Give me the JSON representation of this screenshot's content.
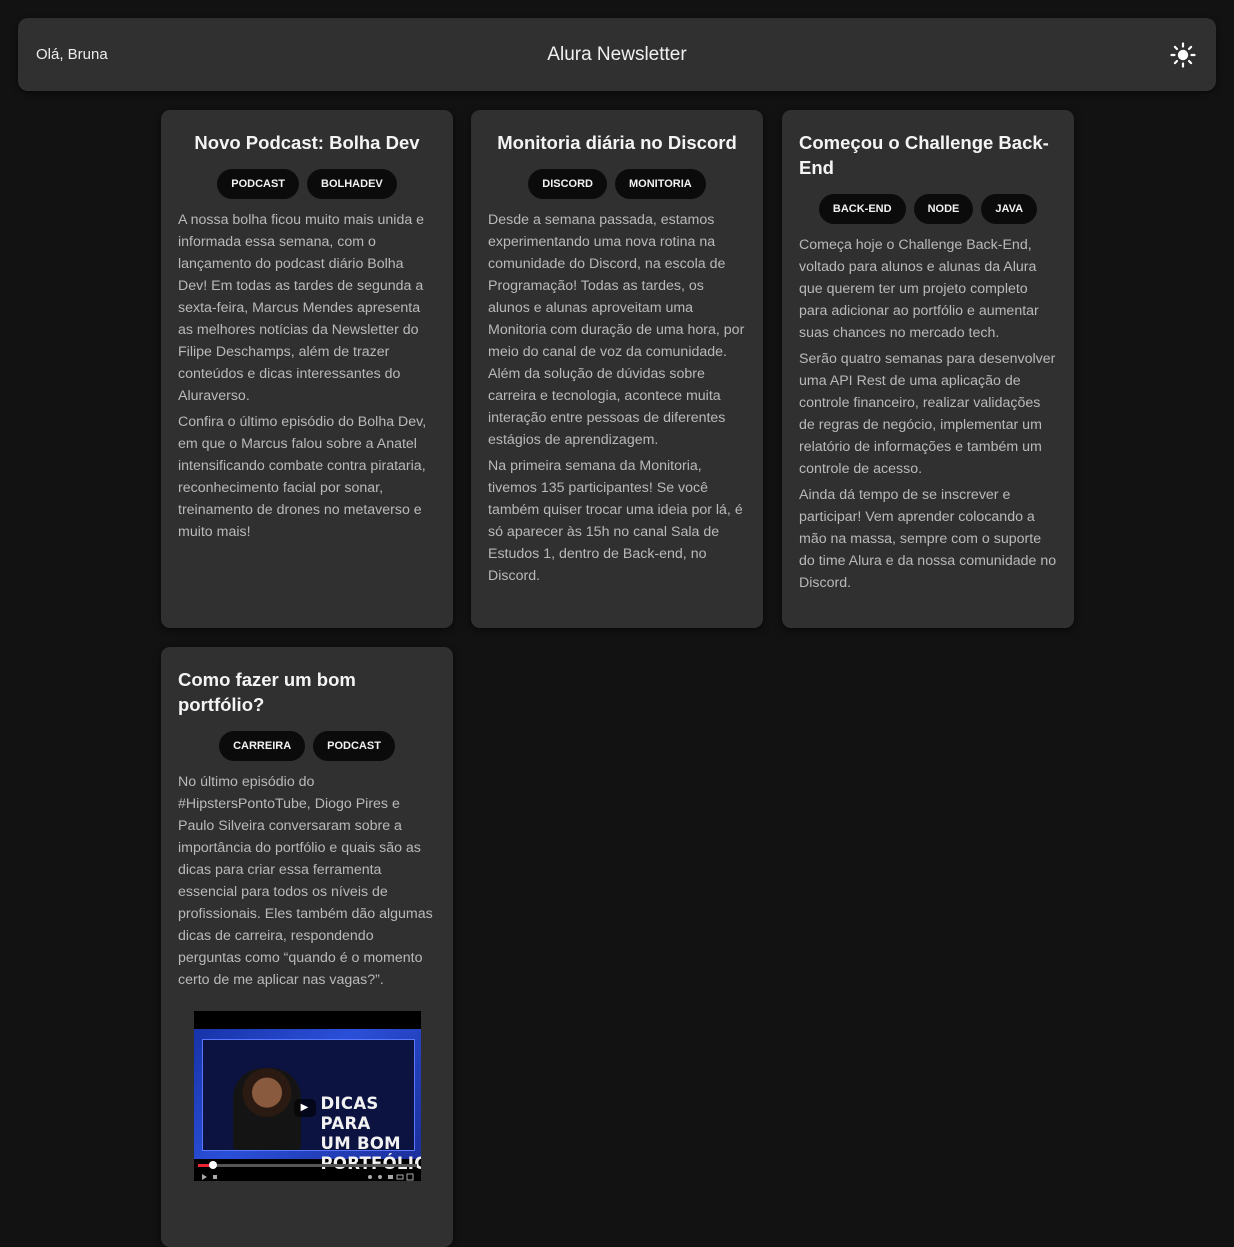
{
  "header": {
    "greeting": "Olá, Bruna",
    "title": "Alura Newsletter",
    "theme_icon": "sun-icon"
  },
  "cards": [
    {
      "title": "Novo Podcast: Bolha Dev",
      "tags": [
        "PODCAST",
        "BOLHADEV"
      ],
      "paragraphs": [
        "A nossa bolha ficou muito mais unida e informada essa semana, com o lançamento do podcast diário Bolha Dev! Em todas as tardes de segunda a sexta-feira, Marcus Mendes apresenta as melhores notícias da Newsletter do Filipe Deschamps, além de trazer conteúdos e dicas interessantes do Aluraverso.",
        "Confira o último episódio do Bolha Dev, em que o Marcus falou sobre a Anatel intensificando combate contra pirataria, reconhecimento facial por sonar, treinamento de drones no metaverso e muito mais!"
      ]
    },
    {
      "title": "Monitoria diária no Discord",
      "tags": [
        "DISCORD",
        "MONITORIA"
      ],
      "paragraphs": [
        "Desde a semana passada, estamos experimentando uma nova rotina na comunidade do Discord, na escola de Programação! Todas as tardes, os alunos e alunas aproveitam uma Monitoria com duração de uma hora, por meio do canal de voz da comunidade. Além da solução de dúvidas sobre carreira e tecnologia, acontece muita interação entre pessoas de diferentes estágios de aprendizagem.",
        "Na primeira semana da Monitoria, tivemos 135 participantes! Se você também quiser trocar uma ideia por lá, é só aparecer às 15h no canal Sala de Estudos 1, dentro de Back-end, no Discord."
      ]
    },
    {
      "title": "Começou o Challenge Back-End",
      "tags": [
        "BACK-END",
        "NODE",
        "JAVA"
      ],
      "paragraphs": [
        "Começa hoje o Challenge Back-End, voltado para alunos e alunas da Alura que querem ter um projeto completo para adicionar ao portfólio e aumentar suas chances no mercado tech.",
        "Serão quatro semanas para desenvolver uma API Rest de uma aplicação de controle financeiro, realizar validações de regras de negócio, implementar um relatório de informações e também um controle de acesso.",
        "Ainda dá tempo de se inscrever e participar! Vem aprender colocando a mão na massa, sempre com o suporte do time Alura e da nossa comunidade no Discord."
      ]
    },
    {
      "title": "Como fazer um bom portfólio?",
      "tags": [
        "CARREIRA",
        "PODCAST"
      ],
      "paragraphs": [
        "No último episódio do #HipstersPontoTube, Diogo Pires e Paulo Silveira conversaram sobre a importância do portfólio e quais são as dicas para criar essa ferramenta essencial para todos os níveis de profissionais. Eles também dão algumas dicas de carreira, respondendo perguntas como “quando é o momento certo de me aplicar nas vagas?”."
      ],
      "video": {
        "thumbnail_text": "DICAS PARA\nUM BOM\nPORTFÓLIO",
        "progress": 0.07
      }
    }
  ]
}
